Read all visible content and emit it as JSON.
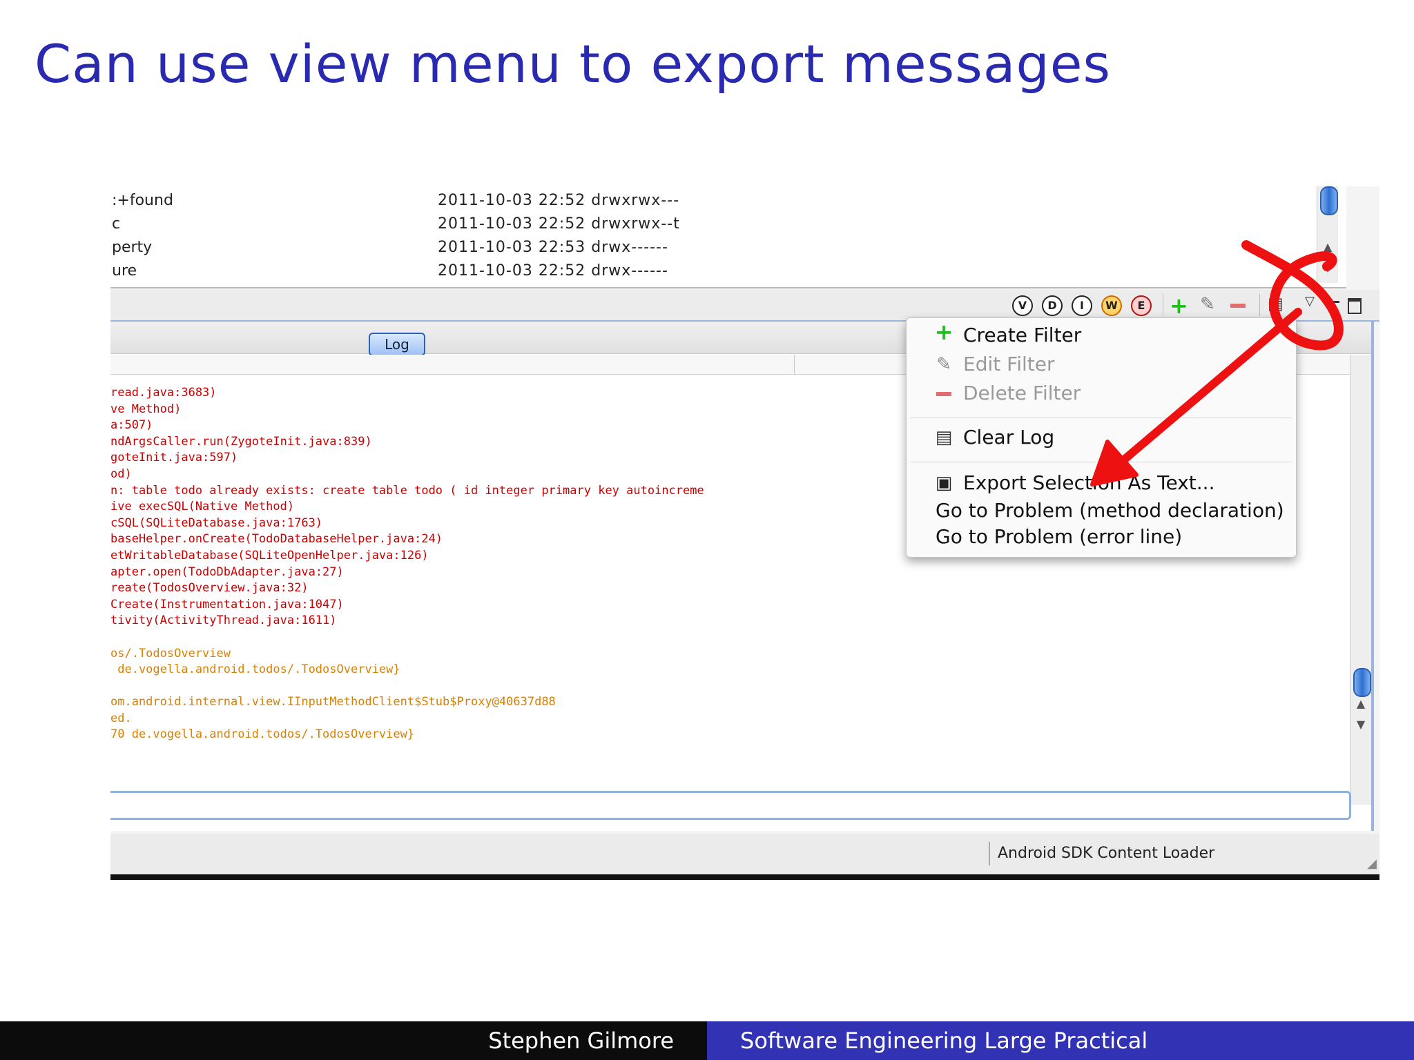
{
  "slide": {
    "title": "Can use view menu to export messages",
    "footer_author": "Stephen Gilmore",
    "footer_course": "Software Engineering Large Practical"
  },
  "file_rows": [
    {
      "name": ":+found",
      "meta": "2011-10-03 22:52 drwxrwx---"
    },
    {
      "name": "c",
      "meta": "2011-10-03 22:52 drwxrwx--t"
    },
    {
      "name": "perty",
      "meta": "2011-10-03 22:53 drwx------"
    },
    {
      "name": "ure",
      "meta": "2011-10-03 22:52 drwx------"
    }
  ],
  "toolbar": {
    "verbose": "V",
    "debug": "D",
    "info": "I",
    "warn": "W",
    "error": "E"
  },
  "log_tab": {
    "label": "Log"
  },
  "log_lines": [
    {
      "text": "read.java:3683)",
      "level": "err"
    },
    {
      "text": "ve Method)",
      "level": "err"
    },
    {
      "text": "a:507)",
      "level": "err"
    },
    {
      "text": "ndArgsCaller.run(ZygoteInit.java:839)",
      "level": "err"
    },
    {
      "text": "goteInit.java:597)",
      "level": "err"
    },
    {
      "text": "od)",
      "level": "err"
    },
    {
      "text": "n: table todo already exists: create table todo ( id integer primary key autoincreme",
      "level": "err"
    },
    {
      "text": "ive execSQL(Native Method)",
      "level": "err"
    },
    {
      "text": "cSQL(SQLiteDatabase.java:1763)",
      "level": "err"
    },
    {
      "text": "baseHelper.onCreate(TodoDatabaseHelper.java:24)",
      "level": "err"
    },
    {
      "text": "etWritableDatabase(SQLiteOpenHelper.java:126)",
      "level": "err"
    },
    {
      "text": "apter.open(TodoDbAdapter.java:27)",
      "level": "err"
    },
    {
      "text": "reate(TodosOverview.java:32)",
      "level": "err"
    },
    {
      "text": "Create(Instrumentation.java:1047)",
      "level": "err"
    },
    {
      "text": "tivity(ActivityThread.java:1611)",
      "level": "err"
    },
    {
      "text": "",
      "level": "blank"
    },
    {
      "text": "os/.TodosOverview",
      "level": "warn"
    },
    {
      "text": " de.vogella.android.todos/.TodosOverview}",
      "level": "warn"
    },
    {
      "text": "",
      "level": "blank"
    },
    {
      "text": "om.android.internal.view.IInputMethodClient$Stub$Proxy@40637d88",
      "level": "warn"
    },
    {
      "text": "ed.",
      "level": "warn"
    },
    {
      "text": "70 de.vogella.android.todos/.TodosOverview}",
      "level": "warn"
    }
  ],
  "menu": {
    "create_filter": "Create Filter",
    "edit_filter": "Edit Filter",
    "delete_filter": "Delete Filter",
    "clear_log": "Clear Log",
    "export_selection": "Export Selection As Text...",
    "goto_method": "Go to Problem (method declaration)",
    "goto_error": "Go to Problem (error line)"
  },
  "status": {
    "loader": "Android SDK Content Loader"
  },
  "colors": {
    "title": "#2a2ab0",
    "log_error": "#cc0000",
    "log_warn": "#d98000",
    "annotation": "#ee1111",
    "footer_left": "#0c0c0c",
    "footer_right": "#3232b4"
  }
}
